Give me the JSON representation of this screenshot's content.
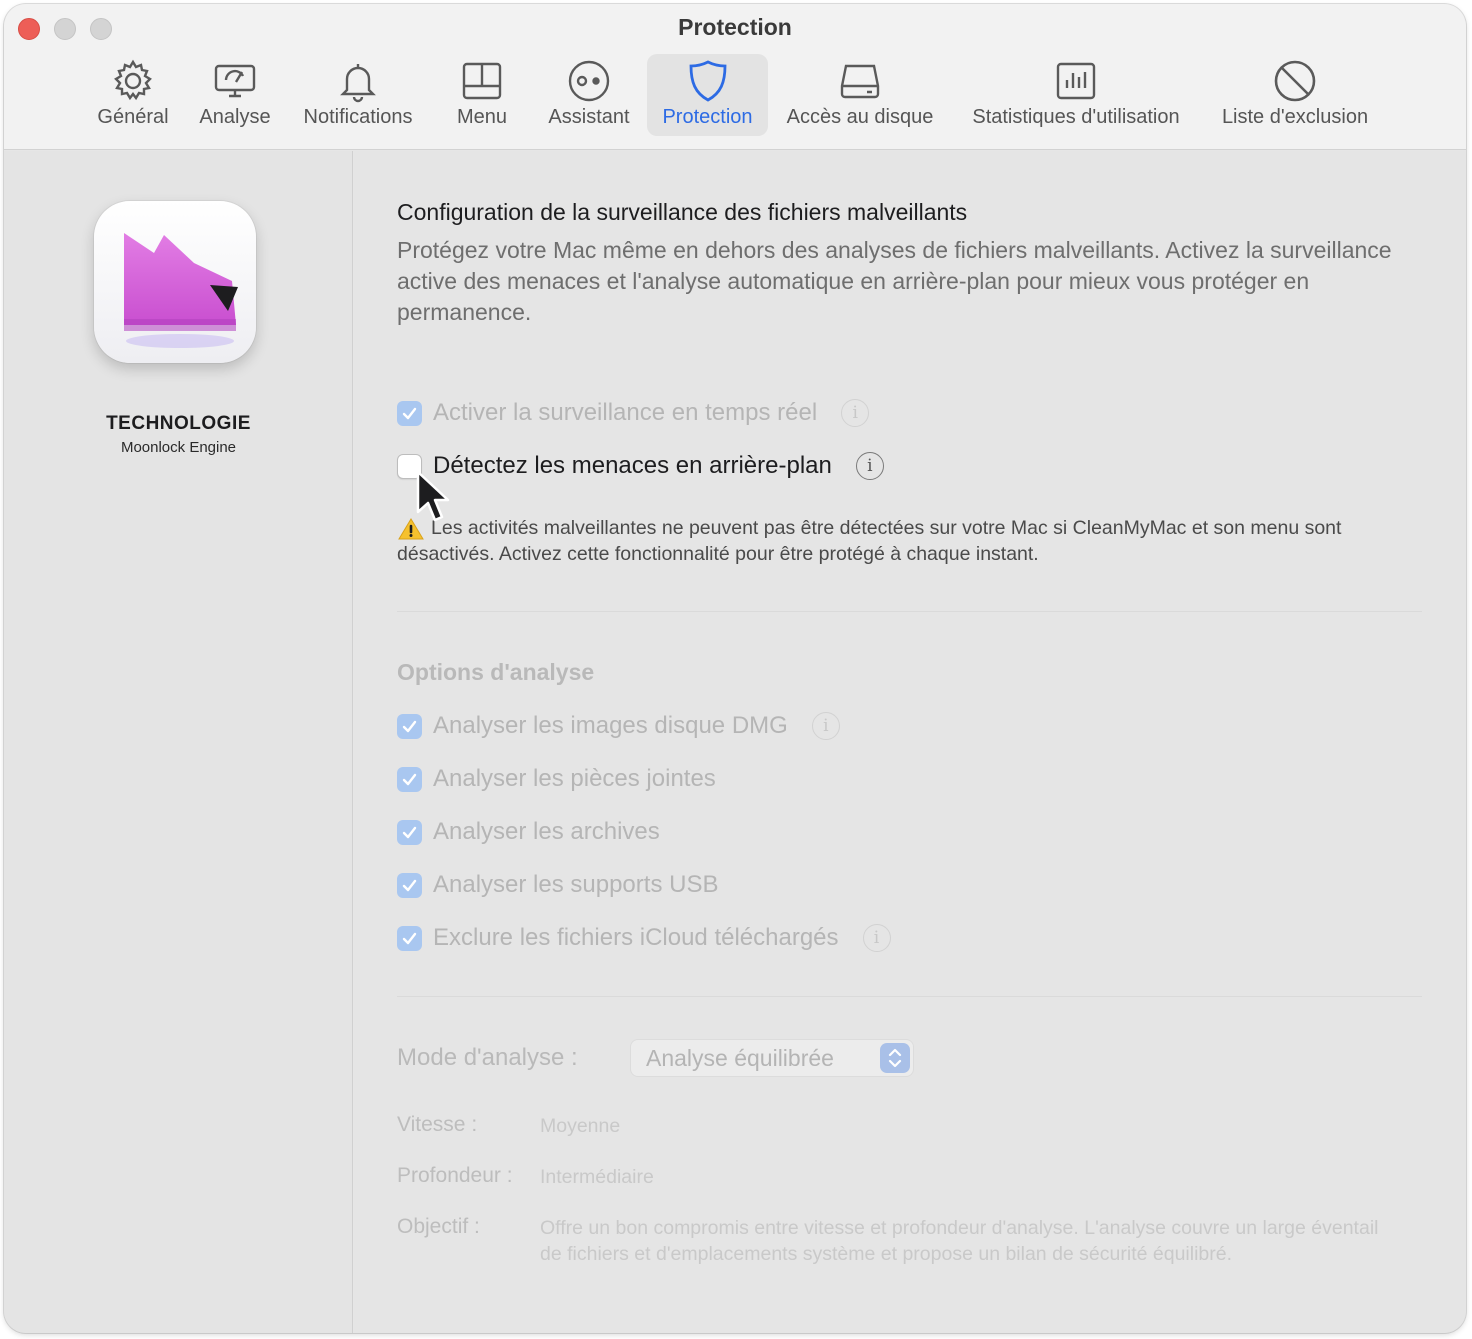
{
  "window": {
    "title": "Protection"
  },
  "toolbar": {
    "tabs": [
      {
        "label": "Général",
        "icon": "gear-icon"
      },
      {
        "label": "Analyse",
        "icon": "monitor-scan-icon"
      },
      {
        "label": "Notifications",
        "icon": "bell-icon"
      },
      {
        "label": "Menu",
        "icon": "menu-window-icon"
      },
      {
        "label": "Assistant",
        "icon": "assistant-face-icon"
      },
      {
        "label": "Protection",
        "icon": "shield-icon",
        "active": true
      },
      {
        "label": "Accès au disque",
        "icon": "disk-icon"
      },
      {
        "label": "Statistiques d'utilisation",
        "icon": "bar-chart-icon"
      },
      {
        "label": "Liste d'exclusion",
        "icon": "prohibited-icon"
      }
    ]
  },
  "sidebar": {
    "tech_title": "TECHNOLOGIE",
    "tech_subtitle": "Moonlock Engine"
  },
  "main": {
    "heading": "Configuration de la surveillance des fichiers malveillants",
    "description": "Protégez votre Mac même en dehors des analyses de fichiers malveillants. Activez la surveillance active des menaces et l'analyse automatique en arrière-plan pour mieux vous protéger en permanence.",
    "realtime": {
      "label": "Activer la surveillance en temps réel",
      "checked": true,
      "enabled": false
    },
    "background": {
      "label": "Détectez les menaces en arrière-plan",
      "checked": false,
      "enabled": true
    },
    "warning": "Les activités malveillantes ne peuvent pas être détectées sur votre Mac si CleanMyMac et son menu sont désactivés. Activez cette fonctionnalité pour être protégé à chaque instant.",
    "options_title": "Options d'analyse",
    "options": [
      {
        "label": "Analyser les images disque DMG",
        "checked": true,
        "info": true
      },
      {
        "label": "Analyser les pièces jointes",
        "checked": true,
        "info": false
      },
      {
        "label": "Analyser les archives",
        "checked": true,
        "info": false
      },
      {
        "label": "Analyser les supports USB",
        "checked": true,
        "info": false
      },
      {
        "label": "Exclure les fichiers iCloud téléchargés",
        "checked": true,
        "info": true
      }
    ],
    "mode_label": "Mode d'analyse :",
    "mode_value": "Analyse équilibrée",
    "speed_label": "Vitesse :",
    "speed_value": "Moyenne",
    "depth_label": "Profondeur :",
    "depth_value": "Intermédiaire",
    "goal_label": "Objectif :",
    "goal_value": "Offre un bon compromis entre vitesse et profondeur d'analyse. L'analyse couvre un large éventail de fichiers et d'emplacements système et propose un bilan de sécurité équilibré.",
    "info_glyph": "i"
  },
  "colors": {
    "accent": "#2d6be4",
    "close": "#ed5e57",
    "checkbox_disabled": "#a9c7f0",
    "app_icon_pink": "#d96ad9"
  }
}
